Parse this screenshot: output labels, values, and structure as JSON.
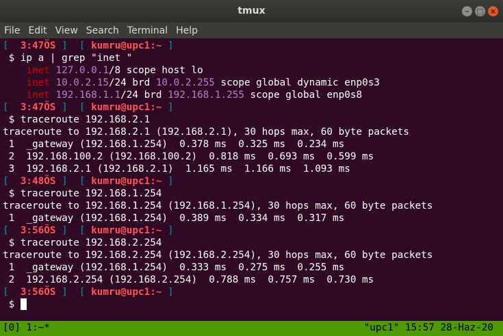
{
  "window": {
    "title": "tmux",
    "buttons": {
      "minimize": "–",
      "maximize": "□",
      "close": "×"
    }
  },
  "menu": [
    "File",
    "Edit",
    "View",
    "Search",
    "Terminal",
    "Help"
  ],
  "prompt": {
    "open": "[",
    "close": "]",
    "user_host": "kumru@upc1:~",
    "symbol": "$"
  },
  "lines": {
    "l1_time": "3:47ÖS",
    "l2_cmd": "ip a | grep \"inet \"",
    "l3": {
      "kw": "inet",
      "addr": "127.0.0.1",
      "rest": "/8 scope host lo"
    },
    "l4": {
      "kw": "inet",
      "addr": "10.0.2.15",
      "mid": "/24 brd ",
      "brd": "10.0.2.255",
      "rest": " scope global dynamic enp0s3"
    },
    "l5": {
      "kw": "inet",
      "addr": "192.168.1.1",
      "mid": "/24 brd ",
      "brd": "192.168.1.255",
      "rest": " scope global enp0s8"
    },
    "l6_time": "3:47ÖS",
    "l7_cmd": "traceroute 192.168.2.1",
    "l8": "traceroute to 192.168.2.1 (192.168.2.1), 30 hops max, 60 byte packets",
    "l9": " 1  _gateway (192.168.1.254)  0.378 ms  0.325 ms  0.234 ms",
    "l10": " 2  192.168.100.2 (192.168.100.2)  0.818 ms  0.693 ms  0.599 ms",
    "l11": " 3  192.168.2.1 (192.168.2.1)  1.165 ms  1.166 ms  1.093 ms",
    "l12_time": "3:48ÖS",
    "l13_cmd": "traceroute 192.168.1.254",
    "l14": "traceroute to 192.168.1.254 (192.168.1.254), 30 hops max, 60 byte packets",
    "l15": " 1  _gateway (192.168.1.254)  0.389 ms  0.334 ms  0.317 ms",
    "l16_time": "3:56ÖS",
    "l17_cmd": "traceroute 192.168.2.254",
    "l18": "traceroute to 192.168.2.254 (192.168.2.254), 30 hops max, 60 byte packets",
    "l19": " 1  _gateway (192.168.1.254)  0.333 ms  0.275 ms  0.255 ms",
    "l20": " 2  192.168.2.254 (192.168.2.254)  0.788 ms  0.757 ms  0.730 ms",
    "l21_time": "3:56ÖS"
  },
  "statusbar": {
    "left": "[0] 1:~*",
    "right": "\"upc1\" 15:57 28-Haz-20"
  },
  "colors": {
    "terminal_bg": "#300a24",
    "status_bg": "#4e9a06",
    "bracket": "#06989a",
    "prompt_red": "#ff5555",
    "dim_addr": "#b680c8"
  }
}
